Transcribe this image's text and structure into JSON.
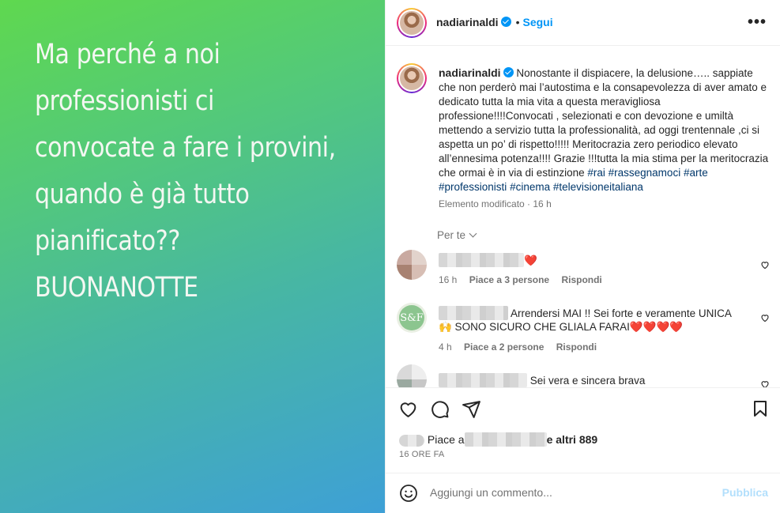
{
  "media": {
    "lines": [
      "Ma perché a noi",
      "professionisti ci",
      "convocate a fare i provini,",
      "quando è già tutto",
      "pianificato??",
      "BUONANOTTE"
    ]
  },
  "header": {
    "username": "nadiarinaldi",
    "dot": "•",
    "follow_label": "Segui",
    "more_label": "•••"
  },
  "caption": {
    "username": "nadiarinaldi",
    "text": "Nonostante il dispiacere, la delusione….. sappiate che non perderò mai l’autostima e la consapevolezza di aver amato e dedicato tutta la mia vita a questa meravigliosa professione!!!!Convocati , selezionati e con devozione e umiltà mettendo a servizio tutta la professionalità, ad oggi trentennale ,ci si aspetta un po’ di rispetto!!!!! Meritocrazia zero periodico elevato all’ennesima potenza!!!! Grazie !!!tutta la mia stima per la meritocrazia che ormai è in via di estinzione ",
    "hashtags": [
      "#rai",
      "#rassegnamoci",
      "#arte",
      "#professionisti",
      "#cinema",
      "#televisioneitaliana"
    ],
    "meta": "Elemento modificato · 16 h"
  },
  "for_you": {
    "label": "Per te"
  },
  "comments": [
    {
      "text": "❤️",
      "time": "16 h",
      "likes": "Piace a 3 persone",
      "reply": "Rispondi"
    },
    {
      "text": "Arrendersi MAI !! Sei forte e veramente UNICA",
      "text2": "🙌 SONO SICURO CHE GLIALA FARAI❤️❤️❤️❤️",
      "avatar_text": "S&F",
      "time": "4 h",
      "likes": "Piace a 2 persone",
      "reply": "Rispondi"
    },
    {
      "text": "Sei vera e sincera brava"
    }
  ],
  "likes": {
    "prefix": "Piace a",
    "suffix": "e altri 889"
  },
  "time_ago": "16 ORE FA",
  "composer": {
    "placeholder": "Aggiungi un commento...",
    "publish_label": "Pubblica"
  },
  "colors": {
    "accent": "#0095f6",
    "hashtag": "#00376b",
    "muted": "#737373",
    "heart": "#e0245e"
  }
}
